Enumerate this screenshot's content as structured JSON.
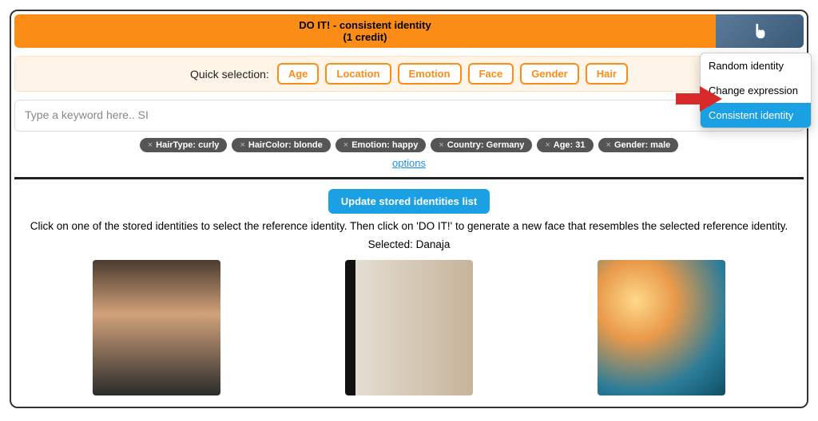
{
  "doit": {
    "title": "DO IT! - consistent identity",
    "sub": "(1 credit)"
  },
  "quick": {
    "label": "Quick selection:",
    "items": [
      "Age",
      "Location",
      "Emotion",
      "Face",
      "Gender",
      "Hair"
    ]
  },
  "search": {
    "placeholder": "Type a keyword here.. SI"
  },
  "tags": [
    "HairType: curly",
    "HairColor: blonde",
    "Emotion: happy",
    "Country: Germany",
    "Age: 31",
    "Gender: male"
  ],
  "options_label": "options",
  "update_btn": "Update stored identities list",
  "instructions": "Click on one of the stored identities to select the reference identity. Then click on 'DO IT!' to generate a new face that resembles the selected reference identity.",
  "selected_prefix": "Selected: ",
  "selected_name": "Danaja",
  "dropdown": {
    "items": [
      "Random identity",
      "Change expression",
      "Consistent identity"
    ],
    "active_index": 2
  }
}
